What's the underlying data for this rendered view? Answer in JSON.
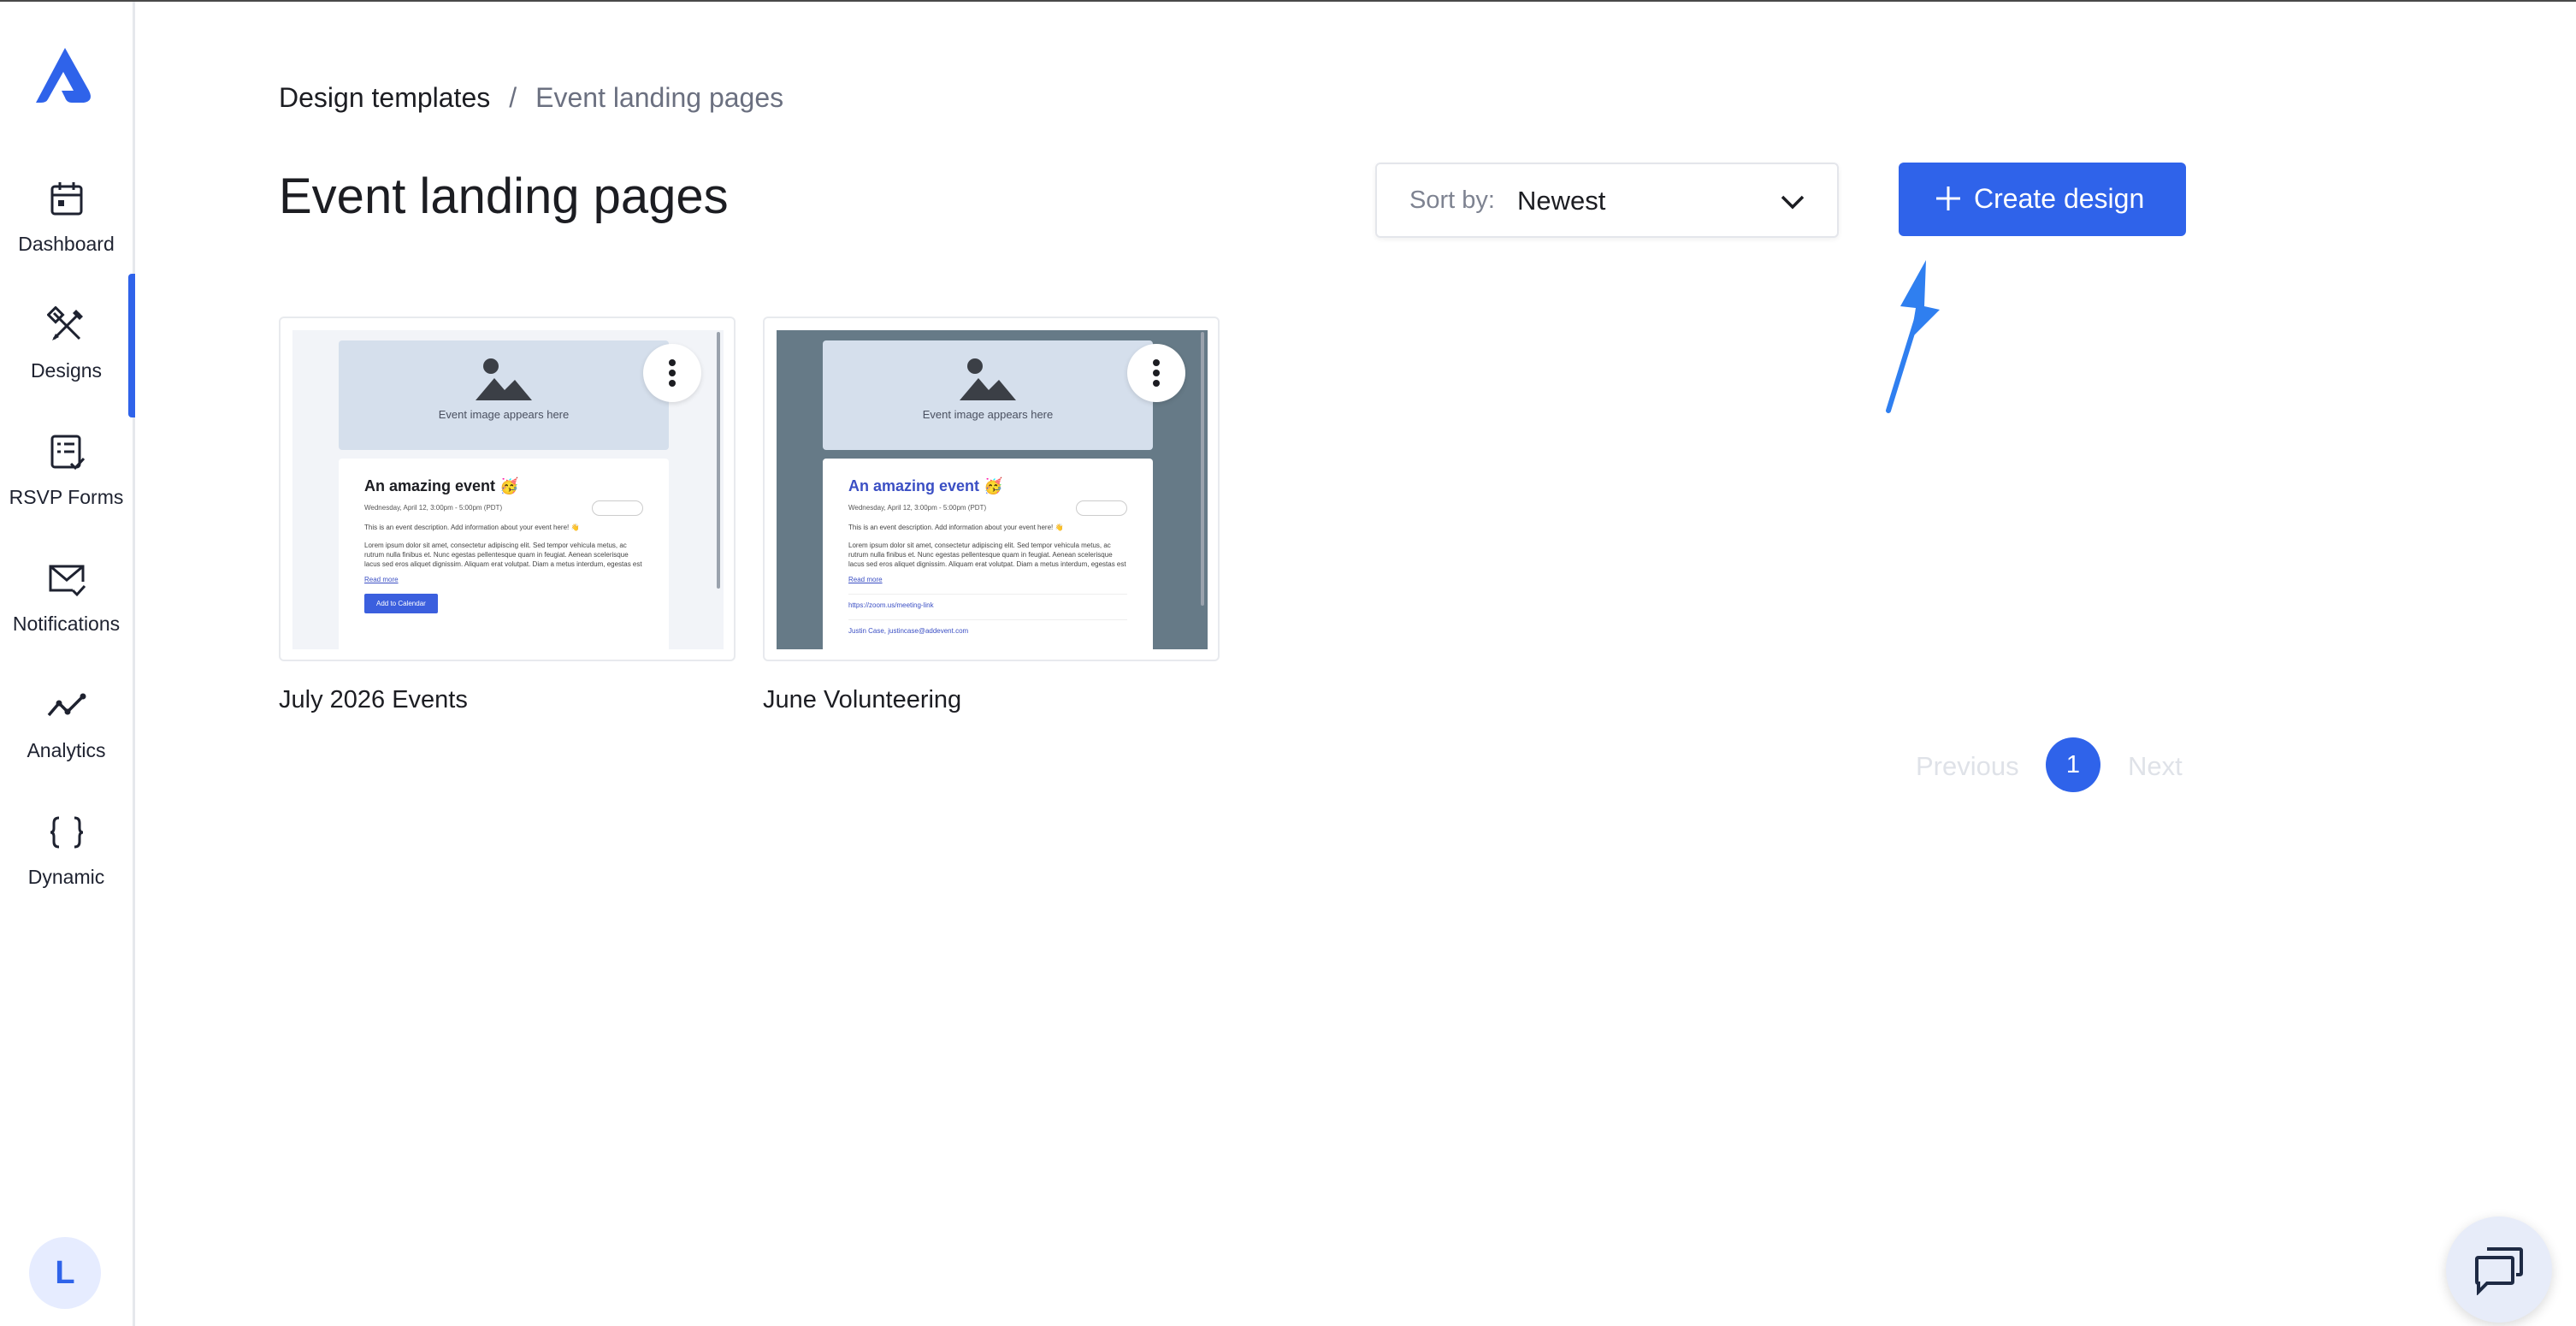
{
  "colors": {
    "accent": "#2f63ea",
    "text": "#1c1d22",
    "muted": "#6b7080",
    "disabled": "#dfe2e8"
  },
  "sidebar": {
    "logo_icon": "brand-logo-icon",
    "items": [
      {
        "label": "Dashboard",
        "icon": "calendar-icon",
        "active": false
      },
      {
        "label": "Designs",
        "icon": "design-tools-icon",
        "active": true
      },
      {
        "label": "RSVP Forms",
        "icon": "form-check-icon",
        "active": false
      },
      {
        "label": "Notifications",
        "icon": "mail-check-icon",
        "active": false
      },
      {
        "label": "Analytics",
        "icon": "line-chart-icon",
        "active": false
      },
      {
        "label": "Dynamic",
        "icon": "curly-braces-icon",
        "active": false
      }
    ],
    "avatar_initial": "L"
  },
  "breadcrumb": {
    "root": "Design templates",
    "separator": "/",
    "current": "Event landing pages"
  },
  "header": {
    "title": "Event landing pages",
    "sort_label": "Sort by:",
    "sort_value": "Newest",
    "create_label": "Create design"
  },
  "cards": [
    {
      "title": "July 2026 Events",
      "preview": {
        "image_caption": "Event image appears here",
        "event_title": "An amazing event 🥳",
        "date_text": "Wednesday, April 12, 3:00pm - 5:00pm (PDT)",
        "description": "This is an event description. Add information about your event here! 👋",
        "lorem": "Lorem ipsum dolor sit amet, consectetur adipiscing elit. Sed tempor vehicula metus, ac rutrum nulla finibus et. Nunc egestas pellentesque quam in feugiat. Aenean scelerisque lacus sed eros aliquet dignissim. Aliquam erat volutpat. Diam a metus interdum, egestas est",
        "read_more": "Read more",
        "button": "Add to Calendar"
      }
    },
    {
      "title": "June Volunteering",
      "preview": {
        "image_caption": "Event image appears here",
        "event_title": "An amazing event 🥳",
        "date_text": "Wednesday, April 12, 3:00pm - 5:00pm (PDT)",
        "description": "This is an event description. Add information about your event here! 👋",
        "lorem": "Lorem ipsum dolor sit amet, consectetur adipiscing elit. Sed tempor vehicula metus, ac rutrum nulla finibus et. Nunc egestas pellentesque quam in feugiat. Aenean scelerisque lacus sed eros aliquet dignissim. Aliquam erat volutpat. Diam a metus interdum, egestas est",
        "read_more": "Read more",
        "link": "https://zoom.us/meeting-link",
        "host": "Justin Case, justincase@addevent.com"
      }
    }
  ],
  "pagination": {
    "previous": "Previous",
    "current_page": "1",
    "next": "Next"
  },
  "chat": {
    "icon": "chat-bubbles-icon"
  }
}
